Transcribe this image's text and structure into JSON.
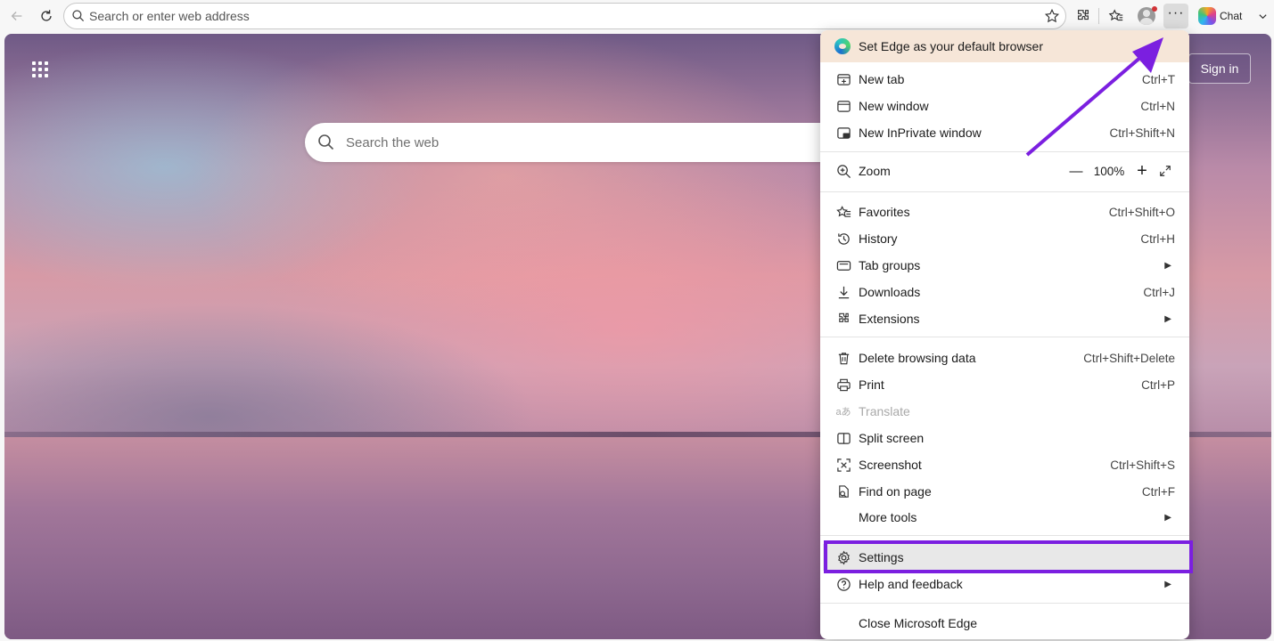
{
  "toolbar": {
    "address_placeholder": "Search or enter web address",
    "chat_label": "Chat"
  },
  "page": {
    "search_placeholder": "Search the web",
    "signin_label": "Sign in"
  },
  "menu": {
    "banner": "Set Edge as your default browser",
    "new_tab": {
      "label": "New tab",
      "shortcut": "Ctrl+T"
    },
    "new_window": {
      "label": "New window",
      "shortcut": "Ctrl+N"
    },
    "new_inprivate": {
      "label": "New InPrivate window",
      "shortcut": "Ctrl+Shift+N"
    },
    "zoom": {
      "label": "Zoom",
      "value": "100%",
      "minus": "—",
      "plus": "+"
    },
    "favorites": {
      "label": "Favorites",
      "shortcut": "Ctrl+Shift+O"
    },
    "history": {
      "label": "History",
      "shortcut": "Ctrl+H"
    },
    "tab_groups": {
      "label": "Tab groups"
    },
    "downloads": {
      "label": "Downloads",
      "shortcut": "Ctrl+J"
    },
    "extensions": {
      "label": "Extensions"
    },
    "delete_browsing": {
      "label": "Delete browsing data",
      "shortcut": "Ctrl+Shift+Delete"
    },
    "print": {
      "label": "Print",
      "shortcut": "Ctrl+P"
    },
    "translate": {
      "label": "Translate"
    },
    "split_screen": {
      "label": "Split screen"
    },
    "screenshot": {
      "label": "Screenshot",
      "shortcut": "Ctrl+Shift+S"
    },
    "find_on_page": {
      "label": "Find on page",
      "shortcut": "Ctrl+F"
    },
    "more_tools": {
      "label": "More tools"
    },
    "settings": {
      "label": "Settings"
    },
    "help": {
      "label": "Help and feedback"
    },
    "close": {
      "label": "Close Microsoft Edge"
    }
  },
  "colors": {
    "annotation": "#7b1fe0",
    "banner": "#f6e6d8"
  }
}
